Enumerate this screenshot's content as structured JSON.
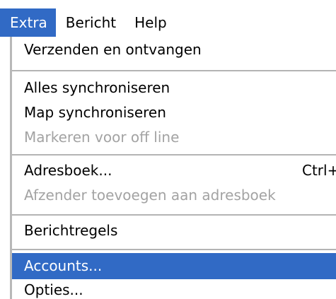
{
  "menubar": {
    "items": [
      {
        "label": "Extra",
        "active": true
      },
      {
        "label": "Bericht",
        "active": false
      },
      {
        "label": "Help",
        "active": false
      }
    ]
  },
  "menu": {
    "items": [
      {
        "label": "Verzenden en ontvangen",
        "enabled": true
      },
      {
        "label": "Alles synchroniseren",
        "enabled": true
      },
      {
        "label": "Map synchroniseren",
        "enabled": true
      },
      {
        "label": "Markeren voor off line",
        "enabled": false
      },
      {
        "label": "Adresboek...",
        "shortcut": "Ctrl+",
        "enabled": true
      },
      {
        "label": "Afzender toevoegen aan adresboek",
        "enabled": false
      },
      {
        "label": "Berichtregels",
        "enabled": true
      },
      {
        "label": "Accounts...",
        "enabled": true,
        "selected": true
      },
      {
        "label": "Opties...",
        "enabled": true
      }
    ]
  },
  "colors": {
    "highlight": "#316ac5",
    "highlight_text": "#ffffff",
    "disabled_text": "#a3a3a3"
  }
}
